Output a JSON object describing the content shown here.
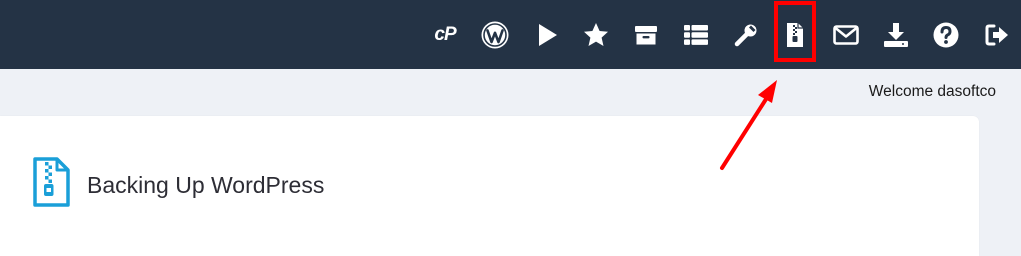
{
  "toolbar": {
    "logo_text": "cP",
    "icons": [
      "cpanel-logo-icon",
      "wordpress-icon",
      "play-icon",
      "star-icon",
      "archive-icon",
      "list-icon",
      "wrench-icon",
      "zip-file-icon",
      "mail-icon",
      "download-icon",
      "help-icon",
      "logout-icon"
    ],
    "highlighted_icon": "zip-file-icon",
    "highlight_color": "#ff0000"
  },
  "welcome_text": "Welcome dasoftco",
  "card": {
    "title": "Backing Up WordPress",
    "icon": "zip-file-icon",
    "icon_color": "#1a9fd8"
  },
  "colors": {
    "topbar": "#243345",
    "page_background": "#eef1f6",
    "annotation_arrow": "#ff0000"
  }
}
